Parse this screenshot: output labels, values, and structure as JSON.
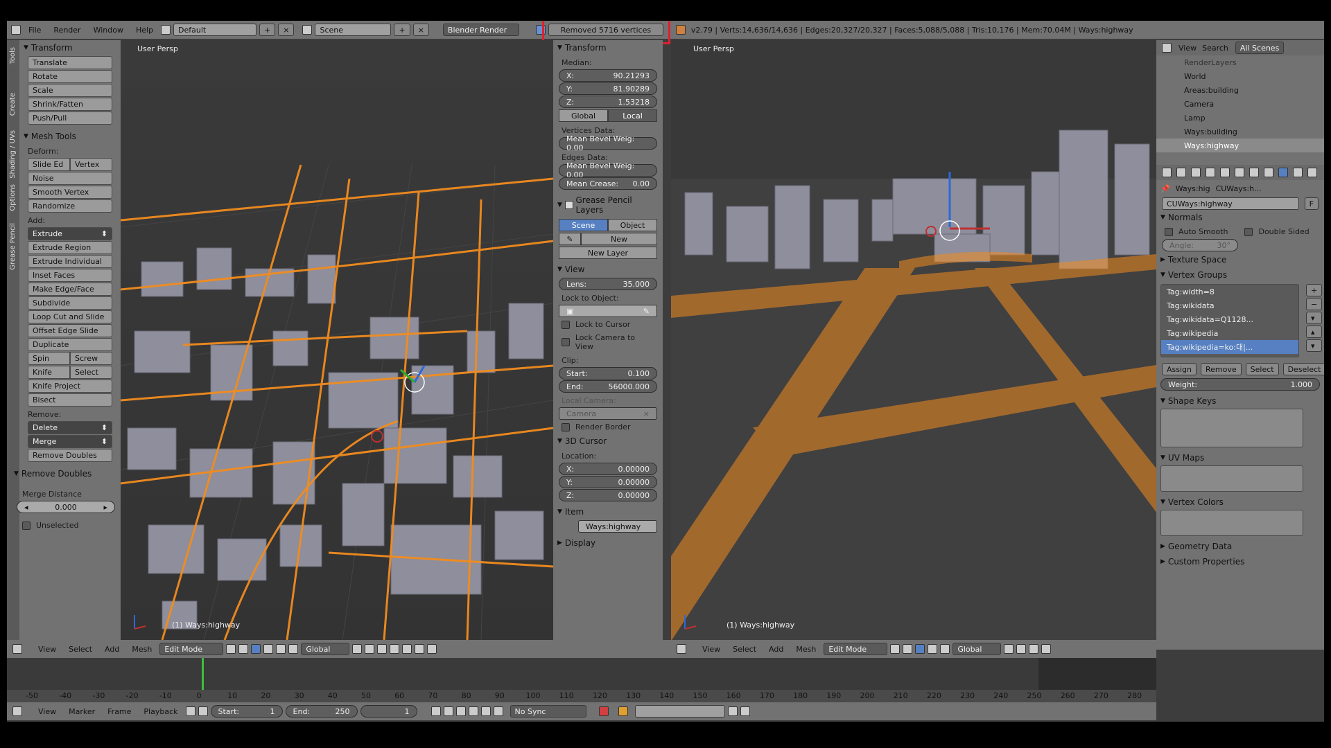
{
  "menu": {
    "items": [
      "File",
      "Render",
      "Window",
      "Help"
    ],
    "layout": "Default",
    "scene": "Scene",
    "engine": "Blender Render",
    "notice": "Removed 5716 vertices",
    "stats": "v2.79 | Verts:14,636/14,636 | Edges:20,327/20,327 | Faces:5,088/5,088 | Tris:10,176 | Mem:70.04M | Ways:highway"
  },
  "tools": {
    "tabs": [
      "Tools",
      "Create",
      "Shading / UVs",
      "Options",
      "Grease Pencil"
    ],
    "transform_header": "Transform",
    "transform": [
      "Translate",
      "Rotate",
      "Scale",
      "Shrink/Fatten",
      "Push/Pull"
    ],
    "mesh_tools_header": "Mesh Tools",
    "deform_label": "Deform:",
    "slide_edge": "Slide Ed",
    "vertex": "Vertex",
    "deform": [
      "Noise",
      "Smooth Vertex",
      "Randomize"
    ],
    "add_label": "Add:",
    "extrude": "Extrude",
    "add": [
      "Extrude Region",
      "Extrude Individual",
      "Inset Faces",
      "Make Edge/Face",
      "Subdivide",
      "Loop Cut and Slide",
      "Offset Edge Slide",
      "Duplicate"
    ],
    "spin": "Spin",
    "screw": "Screw",
    "knife": "Knife",
    "select": "Select",
    "knife_project": "Knife Project",
    "bisect": "Bisect",
    "remove_label": "Remove:",
    "delete": "Delete",
    "merge": "Merge",
    "remove_doubles_btn": "Remove Doubles",
    "op_header": "Remove Doubles",
    "merge_distance_label": "Merge Distance",
    "merge_distance": "0.000",
    "unselected": "Unselected"
  },
  "left_viewport": {
    "label": "User Persp",
    "object": "(1) Ways:highway"
  },
  "right_viewport": {
    "label": "User Persp",
    "object": "(1) Ways:highway"
  },
  "npanel": {
    "transform": "Transform",
    "median": "Median:",
    "x": "90.21293",
    "y": "81.90289",
    "z": "1.53218",
    "global": "Global",
    "local": "Local",
    "vertices_data": "Vertices Data:",
    "mean_bevel_v": "Mean Bevel Weig: 0.00",
    "edges_data": "Edges Data:",
    "mean_bevel_e": "Mean Bevel Weig: 0.00",
    "mean_crease_label": "Mean Crease:",
    "mean_crease": "0.00",
    "gp_header": "Grease Pencil Layers",
    "scene": "Scene",
    "object": "Object",
    "new": "New",
    "new_layer": "New Layer",
    "view_header": "View",
    "lens_label": "Lens:",
    "lens": "35.000",
    "lock_to_object": "Lock to Object:",
    "lock_to_cursor": "Lock to Cursor",
    "lock_camera": "Lock Camera to View",
    "clip": "Clip:",
    "start_label": "Start:",
    "start": "0.100",
    "end_label": "End:",
    "end": "56000.000",
    "local_camera": "Local Camera:",
    "camera": "Camera",
    "render_border": "Render Border",
    "cursor_header": "3D Cursor",
    "location": "Location:",
    "cx": "0.00000",
    "cy": "0.00000",
    "cz": "0.00000",
    "item_header": "Item",
    "item_name": "Ways:highway",
    "display_header": "Display"
  },
  "outliner": {
    "view": "View",
    "search": "Search",
    "all_scenes": "All Scenes",
    "items": [
      "RenderLayers",
      "World",
      "Areas:building",
      "Camera",
      "Lamp",
      "Ways:building",
      "Ways:highway"
    ]
  },
  "properties": {
    "crumb_object": "Ways:hig",
    "crumb_data": "CUWays:h...",
    "data_name": "CUWays:highway",
    "f": "F",
    "normals": "Normals",
    "auto_smooth": "Auto Smooth",
    "double_sided": "Double Sided",
    "angle": "Angle:",
    "angle_value": "30°",
    "texture_space": "Texture Space",
    "vertex_groups": "Vertex Groups",
    "groups": [
      "Tag:width=8",
      "Tag:wikidata",
      "Tag:wikidata=Q1128...",
      "Tag:wikipedia",
      "Tag:wikipedia=ko:대|..."
    ],
    "assign": "Assign",
    "remove": "Remove",
    "select": "Select",
    "deselect": "Deselect",
    "weight_label": "Weight:",
    "weight": "1.000",
    "shape_keys": "Shape Keys",
    "uv_maps": "UV Maps",
    "vertex_colors": "Vertex Colors",
    "geometry_data": "Geometry Data",
    "custom_properties": "Custom Properties"
  },
  "vp_header": {
    "items": [
      "View",
      "Select",
      "Add",
      "Mesh"
    ],
    "mode": "Edit Mode",
    "orientation": "Global"
  },
  "timeline": {
    "ticks": [
      "-50",
      "-40",
      "-30",
      "-20",
      "-10",
      "0",
      "10",
      "20",
      "30",
      "40",
      "50",
      "60",
      "70",
      "80",
      "90",
      "100",
      "110",
      "120",
      "130",
      "140",
      "150",
      "160",
      "170",
      "180",
      "190",
      "200",
      "210",
      "220",
      "230",
      "240",
      "250",
      "260",
      "270",
      "280"
    ],
    "menu": [
      "View",
      "Marker",
      "Frame",
      "Playback"
    ],
    "start_label": "Start:",
    "start": "1",
    "end_label": "End:",
    "end": "250",
    "current": "1",
    "sync": "No Sync"
  },
  "colors": {
    "accent": "#5680c2",
    "highlight_box": "#e02030",
    "selected_edges": "#f28c1e"
  }
}
